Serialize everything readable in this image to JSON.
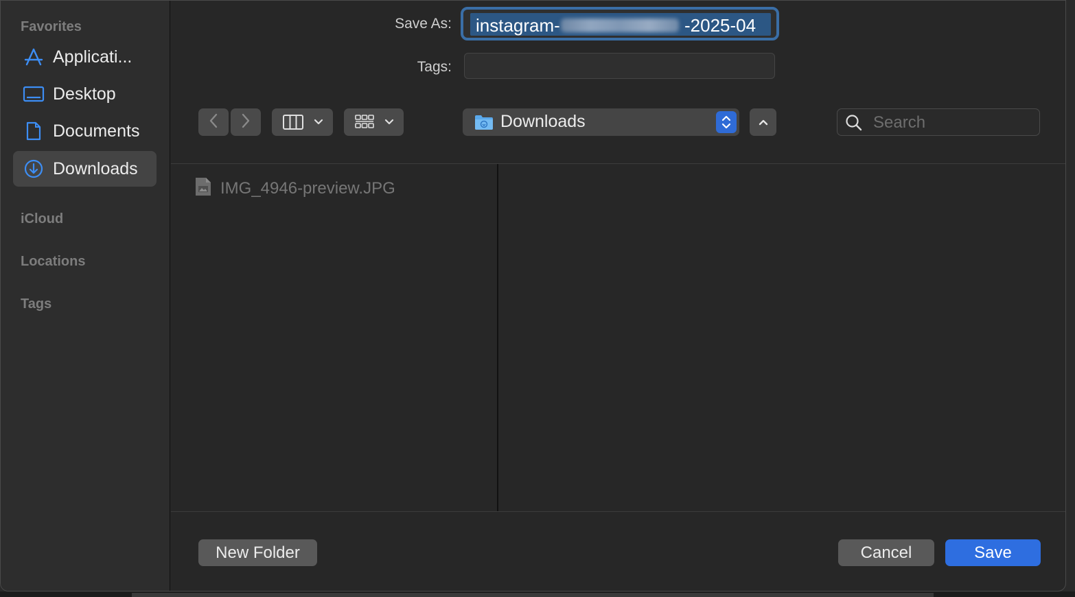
{
  "sidebar": {
    "favorites_title": "Favorites",
    "items": [
      {
        "label": "Applicati...",
        "icon": "applications-icon"
      },
      {
        "label": "Desktop",
        "icon": "desktop-icon"
      },
      {
        "label": "Documents",
        "icon": "documents-icon"
      },
      {
        "label": "Downloads",
        "icon": "downloads-icon",
        "selected": true
      }
    ],
    "icloud_title": "iCloud",
    "locations_title": "Locations",
    "tags_title": "Tags"
  },
  "form": {
    "save_as_label": "Save As:",
    "save_as_prefix": "instagram-",
    "save_as_suffix": "-2025-04",
    "tags_label": "Tags:",
    "tags_value": ""
  },
  "toolbar": {
    "back_icon": "chevron-left-icon",
    "forward_icon": "chevron-right-icon",
    "view_mode_icon": "columns-view-icon",
    "group_icon": "grid-group-icon",
    "location": "Downloads",
    "search_placeholder": "Search"
  },
  "browser": {
    "files": [
      {
        "name": "IMG_4946-preview.JPG",
        "icon": "image-file-icon",
        "enabled": false
      }
    ]
  },
  "buttons": {
    "new_folder": "New Folder",
    "cancel": "Cancel",
    "save": "Save"
  },
  "colors": {
    "accent": "#2e6ee0",
    "selection": "#2c5784",
    "sidebar_icon": "#3d8ef5"
  }
}
